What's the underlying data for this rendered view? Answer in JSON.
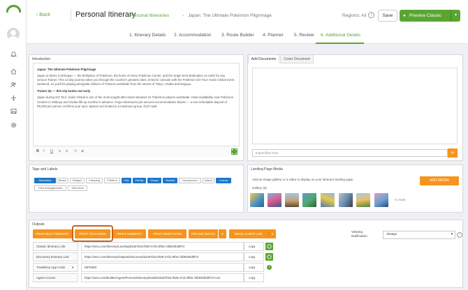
{
  "app": {
    "title": "Personal Itinerary",
    "back_label": "Back",
    "breadcrumb": [
      "Personal Itineraries",
      "Japan: The Ultimate Pokémon Pilgrimage"
    ],
    "regions_label": "Regions:",
    "regions_value": "All",
    "save_label": "Save",
    "preview_label": "Preview Classic",
    "accent": "#5aa532",
    "orange": "#f7941d",
    "blue": "#1e78c8"
  },
  "sidebar": {
    "icons": [
      "bell-icon",
      "home-icon",
      "users-icon",
      "airplane-icon",
      "image-icon",
      "settings-icon"
    ]
  },
  "steps": [
    "1. Itinerary Details",
    "2. Accommodation",
    "3. Route Builder",
    "4. Planner",
    "5. Review",
    "6. Additional Details"
  ],
  "active_step": 5,
  "introduction": {
    "label": "Introduction",
    "heading1": "Japan: The Ultimate Pokémon Pilgrimage",
    "para1": "Japan is where it all began — the birthplace of Pokémon, the home of every Pokémon Center, and the single best destination on earth for any serious Trainer. This 12-day journey takes you through the country's greatest cities, timed to coincide with the Pokémon GO Tour: Kalos Global event weekend, so you'll be playing alongside millions of Trainers worldwide from the streets of Tokyo, Osaka and Nagoya.",
    "heading2": "Trainer tip — this trip books out early",
    "para2": "Japan during GO Tour: Kalos Global is one of the most sought-after travel windows for Pokémon players worldwide. Hotel availability near Pokémon Centers in Shibuya and Osaka fills up months in advance. Pogo Adventures pre-secures accommodation blocks — a non-refundable deposit of R5,000 per person confirms your spot. Spaces are limited to a maximum group. Don't wait.",
    "toolbar": [
      "B",
      "I",
      "U",
      "≡",
      "≡",
      "⊘",
      "◆"
    ]
  },
  "tags": {
    "label": "Tags and Labels",
    "items": [
      {
        "label": "Adventure",
        "on": true
      },
      {
        "label": "Beach",
        "on": false
      },
      {
        "label": "Budget",
        "on": false
      },
      {
        "label": "Camping",
        "on": false
      },
      {
        "label": "Children",
        "on": false
      },
      {
        "label": "City",
        "on": true
      },
      {
        "label": "Family",
        "on": true
      },
      {
        "label": "Group",
        "on": true
      },
      {
        "label": "Guided",
        "on": true
      },
      {
        "label": "Honeymoon",
        "on": false
      },
      {
        "label": "Island",
        "on": false
      },
      {
        "label": "Luxury",
        "on": true
      },
      {
        "label": "Own Arrangements",
        "on": false
      },
      {
        "label": "Self Drive",
        "on": false
      }
    ]
  },
  "documents": {
    "tabs": [
      "Add Documents",
      "Cover Document"
    ],
    "import_placeholder": "Import files from",
    "add_symbol": "+"
  },
  "landing": {
    "label": "Landing Page Media",
    "description": "Add an image gallery or a video to display on your itinerary landing page.",
    "gallery_label": "Gallery (6)",
    "add_media_label": "ADD MEDIA",
    "more_label": "+1 more"
  },
  "outputs": {
    "label": "Outputs",
    "buttons": [
      "PRINTABLE ITINERARY",
      "PRINT VOUCHERS",
      "PRINT SUMMARY",
      "PRINT DIRECTIONS",
      "PRICING (BACK)",
      "▾",
      "EMAIL CLIENT LINK",
      "▾"
    ],
    "viewing_label": "Viewing Notification",
    "viewing_value": "Always",
    "rows": [
      {
        "label": "Classic Itinerary Link",
        "value": "https://vetu.com/Itinerary/Landing/52a07b2a-f829-47d1-8f0a-7db940bd9f72",
        "copy": "copy"
      },
      {
        "label": "Discovery Itinerary Link",
        "value": "https://vetu.com/Itinerary/Outputs/Discovery/52a07b2a-f829-47d1-8f0a-7db940bd9f72",
        "copy": "copy"
      },
      {
        "label": "TravelKey App Code",
        "value": "WPN383",
        "copy": "copy"
      },
      {
        "label": "Agent Access",
        "value": "https://vetu.com/Builder/Agent/PersonalItineraryDetails/52a07b2a-f829-47d1-8f0a-7db940bd9f72?com",
        "copy": "copy"
      }
    ]
  }
}
